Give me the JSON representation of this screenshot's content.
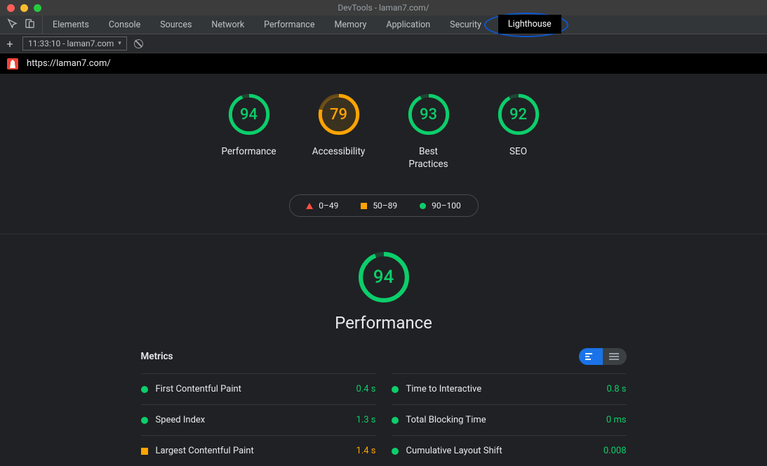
{
  "window_title": "DevTools - laman7.com/",
  "tabs": {
    "elements": "Elements",
    "console": "Console",
    "sources": "Sources",
    "network": "Network",
    "performance": "Performance",
    "memory": "Memory",
    "application": "Application",
    "security": "Security",
    "lighthouse": "Lighthouse"
  },
  "subbar": {
    "report_label": "11:33:10 - laman7.com"
  },
  "url": "https://laman7.com/",
  "scores": {
    "performance": {
      "value": 94,
      "label": "Performance"
    },
    "accessibility": {
      "value": 79,
      "label": "Accessibility"
    },
    "best_practices": {
      "value": 93,
      "label": "Best\nPractices"
    },
    "seo": {
      "value": 92,
      "label": "SEO"
    }
  },
  "legend": {
    "bad": "0–49",
    "mid": "50–89",
    "good": "90–100"
  },
  "perf_section": {
    "score": 94,
    "title": "Performance"
  },
  "metrics": {
    "heading": "Metrics",
    "left": [
      {
        "name": "First Contentful Paint",
        "value": "0.4 s",
        "status": "good"
      },
      {
        "name": "Speed Index",
        "value": "1.3 s",
        "status": "good"
      },
      {
        "name": "Largest Contentful Paint",
        "value": "1.4 s",
        "status": "mid"
      }
    ],
    "right": [
      {
        "name": "Time to Interactive",
        "value": "0.8 s",
        "status": "good"
      },
      {
        "name": "Total Blocking Time",
        "value": "0 ms",
        "status": "good"
      },
      {
        "name": "Cumulative Layout Shift",
        "value": "0.008",
        "status": "good"
      }
    ]
  },
  "chart_data": {
    "type": "gauge",
    "title": "Lighthouse category scores",
    "series": [
      {
        "name": "Performance",
        "value": 94,
        "range": [
          0,
          100
        ],
        "band": "good"
      },
      {
        "name": "Accessibility",
        "value": 79,
        "range": [
          0,
          100
        ],
        "band": "mid"
      },
      {
        "name": "Best Practices",
        "value": 93,
        "range": [
          0,
          100
        ],
        "band": "good"
      },
      {
        "name": "SEO",
        "value": 92,
        "range": [
          0,
          100
        ],
        "band": "good"
      }
    ],
    "bands": [
      {
        "label": "0–49",
        "min": 0,
        "max": 49,
        "color": "#ff4e42"
      },
      {
        "label": "50–89",
        "min": 50,
        "max": 89,
        "color": "#ffa400"
      },
      {
        "label": "90–100",
        "min": 90,
        "max": 100,
        "color": "#0cce6b"
      }
    ]
  }
}
